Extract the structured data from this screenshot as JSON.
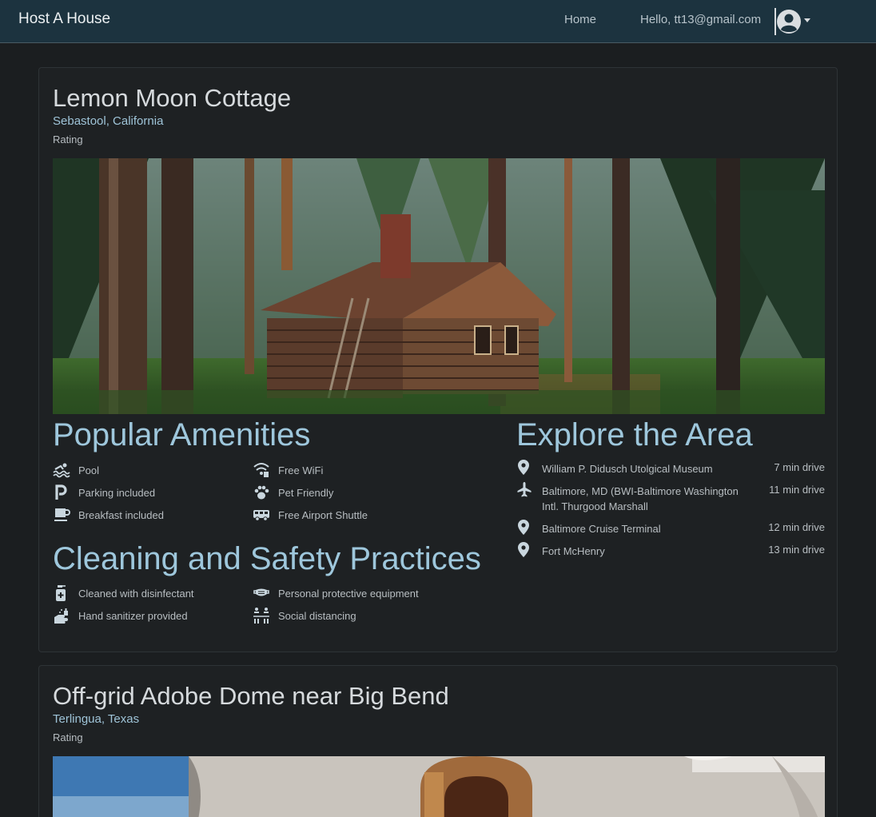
{
  "navbar": {
    "brand": "Host A House",
    "home": "Home",
    "greeting": "Hello, tt13@gmail.com"
  },
  "listings": [
    {
      "title": "Lemon Moon Cottage",
      "location": "Sebastool, California",
      "rating_label": "Rating",
      "image_alt": "cabin-in-forest",
      "amenities_heading": "Popular Amenities",
      "amenities": [
        {
          "label": "Pool",
          "icon": "pool-icon"
        },
        {
          "label": "Free WiFi",
          "icon": "wifi-icon"
        },
        {
          "label": "Parking included",
          "icon": "parking-icon"
        },
        {
          "label": "Pet Friendly",
          "icon": "paw-icon"
        },
        {
          "label": "Breakfast included",
          "icon": "coffee-icon"
        },
        {
          "label": "Free Airport Shuttle",
          "icon": "shuttle-icon"
        }
      ],
      "cleaning_heading": "Cleaning and Safety Practices",
      "cleaning": [
        {
          "label": "Cleaned with disinfectant",
          "icon": "disinfectant-icon"
        },
        {
          "label": "Personal protective equipment",
          "icon": "mask-icon"
        },
        {
          "label": "Hand sanitizer provided",
          "icon": "hand-sanitizer-icon"
        },
        {
          "label": "Social distancing",
          "icon": "social-distancing-icon"
        }
      ],
      "area_heading": "Explore the Area",
      "area": [
        {
          "name": "William P. Didusch Utolgical Museum",
          "time": "7 min drive",
          "icon": "map-pin-icon"
        },
        {
          "name": "Baltimore, MD (BWI-Baltimore Washington Intl. Thurgood Marshall",
          "time": "11 min drive",
          "icon": "plane-icon"
        },
        {
          "name": "Baltimore Cruise Terminal",
          "time": "12 min drive",
          "icon": "map-pin-icon"
        },
        {
          "name": "Fort McHenry",
          "time": "13 min drive",
          "icon": "map-pin-icon"
        }
      ]
    },
    {
      "title": "Off-grid Adobe Dome near Big Bend",
      "location": "Terlingua, Texas",
      "rating_label": "Rating",
      "image_alt": "adobe-dome"
    }
  ],
  "colors": {
    "accent": "#9ec7dc",
    "navbar_bg": "#1c333f",
    "page_bg": "#1b1e20"
  }
}
